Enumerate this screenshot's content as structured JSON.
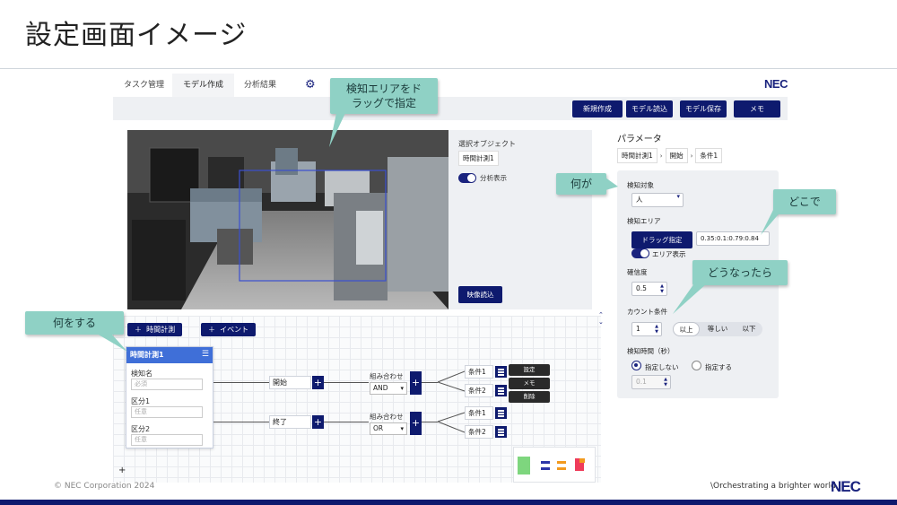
{
  "slide": {
    "title": "設定画面イメージ"
  },
  "tabs": [
    {
      "label": "タスク管理"
    },
    {
      "label": "モデル作成"
    },
    {
      "label": "分析結果"
    }
  ],
  "brand": {
    "small_logo": "NEC",
    "footer_logo": "NEC",
    "tagline": "\\Orchestrating a brighter world",
    "copyright": "© NEC Corporation 2024"
  },
  "toolbar": {
    "new": "新規作成",
    "load": "モデル読込",
    "save": "モデル保存",
    "memo": "メモ"
  },
  "video_panel": {
    "selected_object_label": "選択オブジェクト",
    "selected_object_value": "時間計測1",
    "toggle_label": "分析表示",
    "load_button": "映像読込"
  },
  "flow": {
    "add_time_button": "時間計測",
    "add_event_button": "イベント",
    "node": {
      "title": "時間計測1",
      "fields": [
        {
          "label": "検知名",
          "placeholder": "必須"
        },
        {
          "label": "区分1",
          "placeholder": "任意"
        },
        {
          "label": "区分2",
          "placeholder": "任意"
        }
      ]
    },
    "start_label": "開始",
    "end_label": "終了",
    "combine_label": "組み合わせ",
    "combine_top_value": "AND",
    "combine_bottom_value": "OR",
    "conditions": [
      "条件1",
      "条件2",
      "条件1",
      "条件2"
    ],
    "context_menu": [
      "設定",
      "メモ",
      "削除"
    ],
    "add_canvas": "+"
  },
  "params": {
    "title": "パラメータ",
    "breadcrumb": [
      "時間計測1",
      "開始",
      "条件1"
    ],
    "detect_target_label": "検知対象",
    "detect_target_value": "人",
    "detect_area_label": "検知エリア",
    "drag_button": "ドラッグ指定",
    "area_value": "0.35:0.1:0.79:0.84",
    "area_toggle_label": "エリア表示",
    "confidence_label": "確信度",
    "confidence_value": "0.5",
    "count_label": "カウント条件",
    "count_value": "1",
    "count_options": [
      "以上",
      "等しい",
      "以下"
    ],
    "time_label": "検知時間（秒）",
    "time_options": [
      "指定しない",
      "指定する"
    ],
    "time_value": "0.1"
  },
  "callouts": {
    "area": "検知エリアをド\nラッグで指定",
    "what": "何が",
    "where": "どこで",
    "how": "どうなったら",
    "do": "何をする"
  },
  "colors": {
    "navy": "#0e1a6e",
    "callout": "#8fd1c5",
    "node_header": "#3f6fd8"
  }
}
